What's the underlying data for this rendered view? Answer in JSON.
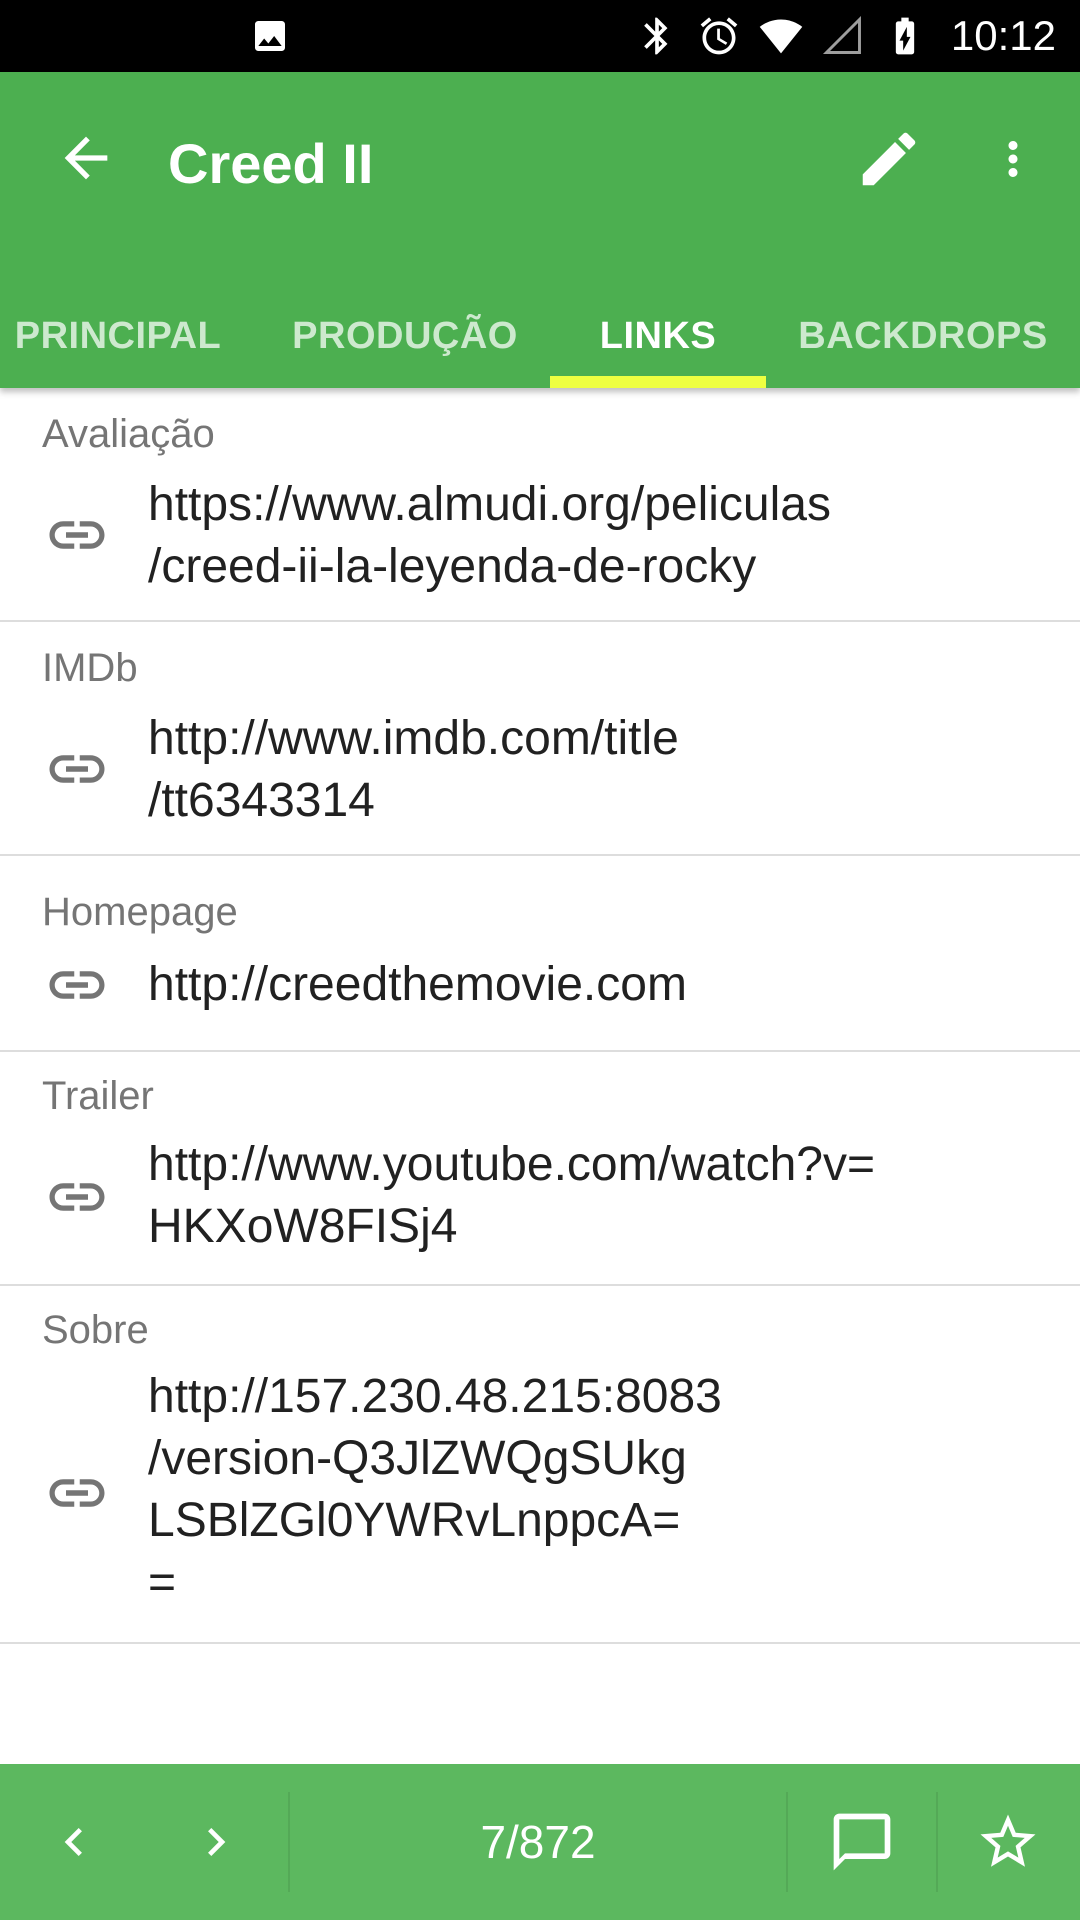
{
  "status_bar": {
    "time": "10:12",
    "icons": [
      "image-icon",
      "bluetooth-icon",
      "alarm-icon",
      "wifi-icon",
      "signal-icon",
      "battery-charging-icon"
    ]
  },
  "app_bar": {
    "title": "Creed II",
    "color": "#4caf50",
    "tabs": [
      {
        "label": "PRINCIPAL",
        "active": false
      },
      {
        "label": "PRODUÇÃO",
        "active": false
      },
      {
        "label": "LINKS",
        "active": true
      },
      {
        "label": "BACKDROPS",
        "active": false
      }
    ],
    "indicator_color": "#eeff41"
  },
  "links": [
    {
      "label": "Avaliação",
      "url": "https://www.almudi.org/peliculas\n/creed-ii-la-leyenda-de-rocky"
    },
    {
      "label": "IMDb",
      "url": "http://www.imdb.com/title\n/tt6343314"
    },
    {
      "label": "Homepage",
      "url": "http://creedthemovie.com"
    },
    {
      "label": "Trailer",
      "url": "http://www.youtube.com/watch?v=\nHKXoW8FISj4"
    },
    {
      "label": "Sobre",
      "url": "http://157.230.48.215:8083\n/version-Q3JlZWQgSUkg\nLSBlZGl0YWRvLnppcA=\n="
    }
  ],
  "bottom_bar": {
    "page_counter": "7/872",
    "color": "#5cb85f"
  }
}
